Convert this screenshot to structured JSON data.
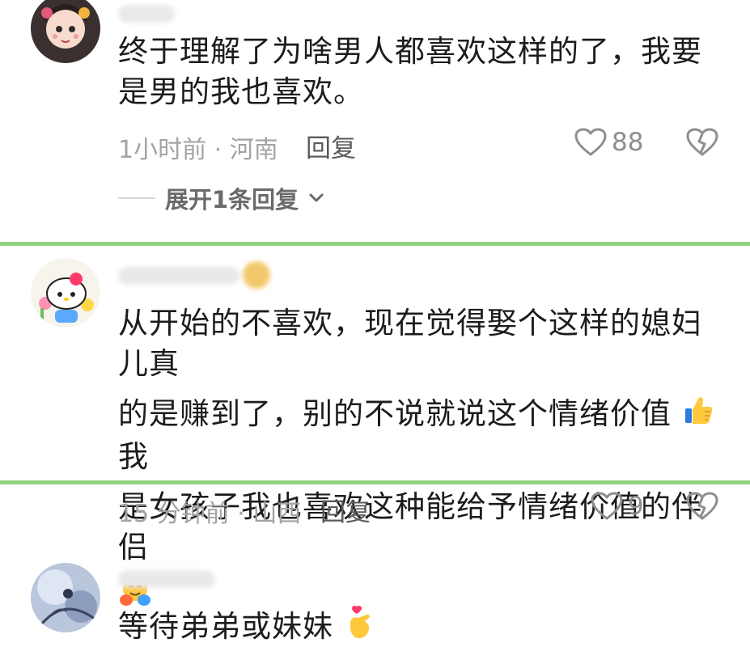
{
  "comments": [
    {
      "text": "终于理解了为啥男人都喜欢这样的了，我要是男的我也喜欢。",
      "time_location": "1小时前 · 河南",
      "reply_label": "回复",
      "like_count": "88",
      "expand_label": "展开1条回复"
    },
    {
      "text_line1": "从开始的不喜欢，现在觉得娶个这样的媳妇儿真",
      "text_line2a": "的是赚到了，别的不说就说这个情绪价值",
      "text_line2b": "我",
      "text_line3": "是女孩子我也喜欢这种能给予情绪价值的伴侣",
      "time_location": "15 分钟前 · 山西",
      "reply_label": "回复",
      "like_count": "9"
    },
    {
      "text": "等待弟弟或妹妹"
    }
  ],
  "icons": {
    "like": "heart-outline-icon",
    "dislike": "broken-heart-icon",
    "expand": "chevron-down-icon",
    "thumbs_up_emoji": "thumbs-up-emoji",
    "hug_emoji": "hugging-face-emoji",
    "finger_heart_emoji": "finger-heart-emoji"
  },
  "colors": {
    "divider": "#8fd37e",
    "meta_text": "#a3a3a3",
    "body_text": "#1c1c1c"
  }
}
